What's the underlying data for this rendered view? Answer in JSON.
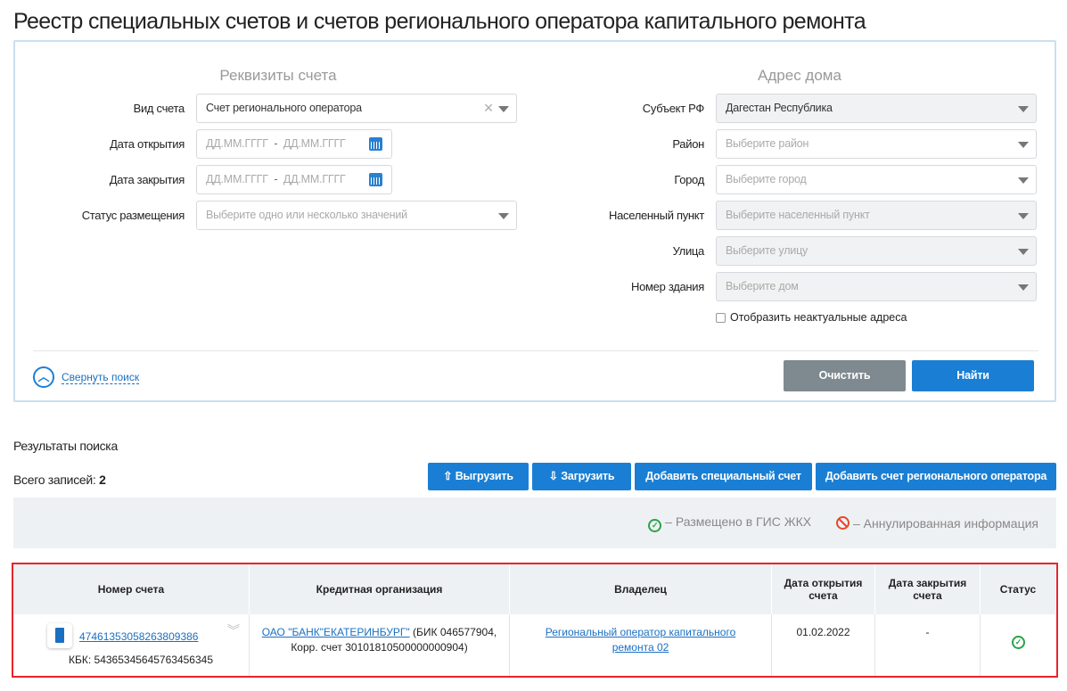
{
  "title": "Реестр специальных счетов и счетов регионального оператора капитального ремонта",
  "search": {
    "left_heading": "Реквизиты счета",
    "right_heading": "Адрес дома",
    "account_type": {
      "label": "Вид счета",
      "value": "Счет регионального оператора"
    },
    "open_date": {
      "label": "Дата открытия",
      "from_placeholder": "ДД.ММ.ГГГГ",
      "to_placeholder": "ДД.ММ.ГГГГ",
      "sep": "-"
    },
    "close_date": {
      "label": "Дата закрытия",
      "from_placeholder": "ДД.ММ.ГГГГ",
      "to_placeholder": "ДД.ММ.ГГГГ",
      "sep": "-"
    },
    "status": {
      "label": "Статус размещения",
      "placeholder": "Выберите одно или несколько значений"
    },
    "subject": {
      "label": "Субъект РФ",
      "value": "Дагестан Республика"
    },
    "district": {
      "label": "Район",
      "placeholder": "Выберите район"
    },
    "city": {
      "label": "Город",
      "placeholder": "Выберите город"
    },
    "settlement": {
      "label": "Населенный пункт",
      "placeholder": "Выберите населенный пункт"
    },
    "street": {
      "label": "Улица",
      "placeholder": "Выберите улицу"
    },
    "building": {
      "label": "Номер здания",
      "placeholder": "Выберите дом"
    },
    "show_inactive": "Отобразить неактуальные адреса",
    "collapse": "Свернуть поиск",
    "clear": "Очистить",
    "find": "Найти"
  },
  "results": {
    "heading": "Результаты поиска",
    "total_label": "Всего записей:",
    "total": "2",
    "export": "Выгрузить",
    "import": "Загрузить",
    "add_special": "Добавить специальный счет",
    "add_regional": "Добавить счет регионального оператора",
    "legend_posted": "–  Размещено в ГИС ЖКХ",
    "legend_annulled": "–  Аннулированная информация",
    "columns": [
      "Номер счета",
      "Кредитная организация",
      "Владелец",
      "Дата открытия счета",
      "Дата закрытия счета",
      "Статус"
    ],
    "rows": [
      {
        "account": "47461353058263809386",
        "kbk": "КБК: 54365345645763456345",
        "bank_link": "ОАО \"БАНК\"ЕКАТЕРИНБУРГ\"",
        "bank_details": " (БИК 046577904, Корр. счет 30101810500000000904)",
        "owner": "Региональный оператор капитального ремонта 02",
        "open_date": "01.02.2022",
        "close_date": "-"
      }
    ]
  },
  "colors": {
    "primary": "#1a7fd4",
    "highlight": "#e8232a",
    "ok": "#2aa34a",
    "annulled": "#e8472a"
  }
}
